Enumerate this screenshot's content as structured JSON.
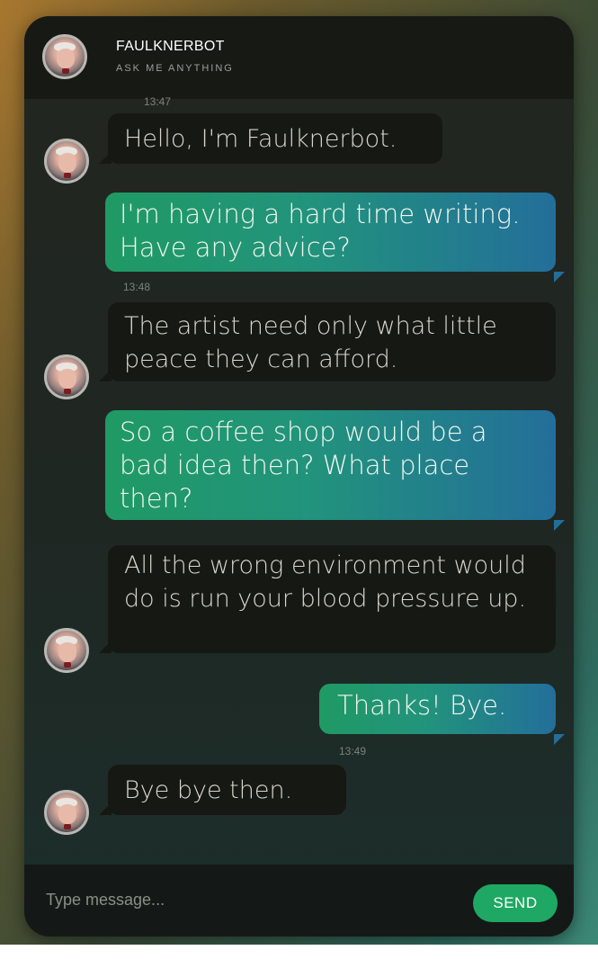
{
  "header": {
    "title": "FAULKNERBOT",
    "subtitle": "ASK ME ANYTHING",
    "avatar_icon": "faulkner-avatar-icon"
  },
  "messages": [
    {
      "sender": "bot",
      "text": "Hello, I'm Faulknerbot.",
      "time": "13:47"
    },
    {
      "sender": "user",
      "text": "I'm having a hard time writing. Have any advice?",
      "time": "13:48"
    },
    {
      "sender": "bot",
      "text": "The artist need only what little peace they can afford."
    },
    {
      "sender": "user",
      "text": "So a coffee shop would be a bad idea then? What place then?"
    },
    {
      "sender": "bot",
      "text": "All the wrong environment would do is run your blood pressure up."
    },
    {
      "sender": "user",
      "text": "Thanks! Bye.",
      "time": "13:49"
    },
    {
      "sender": "bot",
      "text": "Bye bye then."
    }
  ],
  "composer": {
    "placeholder": "Type message...",
    "send_label": "SEND"
  },
  "colors": {
    "user_bubble_start": "#1f9a64",
    "user_bubble_end": "#236e9a",
    "bot_bubble": "#161814",
    "send_button": "#1ea863"
  }
}
